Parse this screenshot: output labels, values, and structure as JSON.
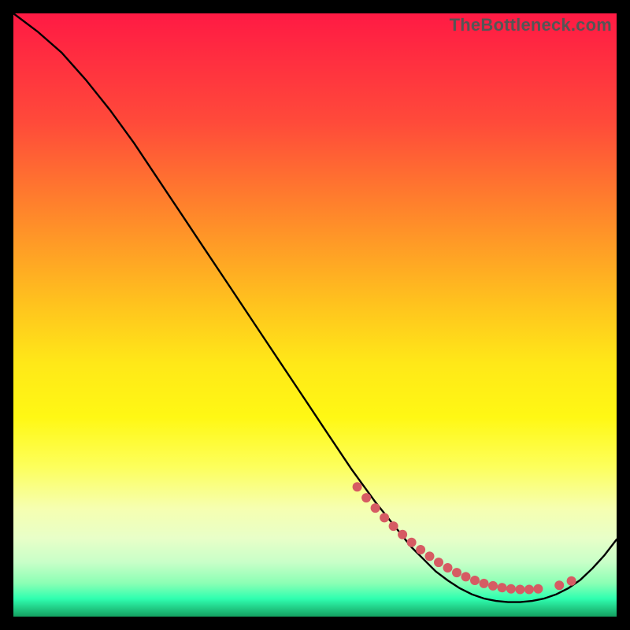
{
  "watermark": "TheBottleneck.com",
  "chart_data": {
    "type": "line",
    "title": "",
    "xlabel": "",
    "ylabel": "",
    "xlim": [
      0,
      100
    ],
    "ylim": [
      0,
      100
    ],
    "series": [
      {
        "name": "bottleneck-curve",
        "x": [
          0,
          4,
          8,
          12,
          16,
          20,
          24,
          28,
          32,
          36,
          40,
          44,
          48,
          52,
          56,
          60,
          64,
          66,
          68,
          70,
          72,
          74,
          76,
          78,
          80,
          82,
          84,
          86,
          88,
          90,
          92,
          94,
          96,
          98,
          100
        ],
        "y": [
          100,
          97,
          93.5,
          89,
          84,
          78.5,
          72.5,
          66.5,
          60.5,
          54.5,
          48.5,
          42.5,
          36.5,
          30.5,
          24.5,
          19,
          14,
          11.5,
          9.5,
          7.5,
          6,
          4.7,
          3.7,
          3.0,
          2.6,
          2.4,
          2.4,
          2.6,
          3.0,
          3.7,
          4.7,
          6.1,
          8.0,
          10.2,
          12.8
        ]
      }
    ],
    "markers": {
      "name": "highlight-dots",
      "color": "#d65b63",
      "x": [
        57,
        58.5,
        60,
        61.5,
        63,
        64.5,
        66,
        67.5,
        69,
        70.5,
        72,
        73.5,
        75,
        76.5,
        78,
        79.5,
        81,
        82.5,
        84,
        85.5,
        87,
        90.5,
        92.5
      ],
      "y": [
        21.5,
        19.7,
        18.0,
        16.4,
        15.0,
        13.6,
        12.3,
        11.1,
        10.0,
        9.0,
        8.1,
        7.3,
        6.6,
        6.0,
        5.5,
        5.1,
        4.8,
        4.6,
        4.5,
        4.5,
        4.6,
        5.2,
        5.9
      ]
    }
  }
}
